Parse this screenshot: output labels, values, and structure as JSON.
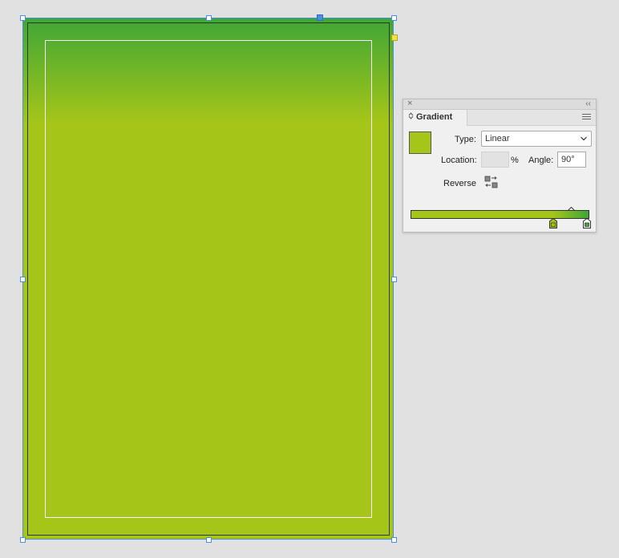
{
  "colors": {
    "pasteboard": "#e1e1e1",
    "gradient_start": "#3ea636",
    "gradient_end": "#a5c518",
    "selection": "#4b8fe0"
  },
  "gradient_panel": {
    "close_icon": "×",
    "collapse_icon": "‹‹",
    "tab_label": "Gradient",
    "type_label": "Type:",
    "type_value": "Linear",
    "location_label": "Location:",
    "location_value": "",
    "percent_sign": "%",
    "angle_label": "Angle:",
    "angle_value": "90°",
    "reverse_label": "Reverse",
    "stops": [
      {
        "color": "#a5c518",
        "location_pct": 80
      },
      {
        "color": "#3ea636",
        "location_pct": 100
      }
    ],
    "midpoint_pct": 90
  }
}
